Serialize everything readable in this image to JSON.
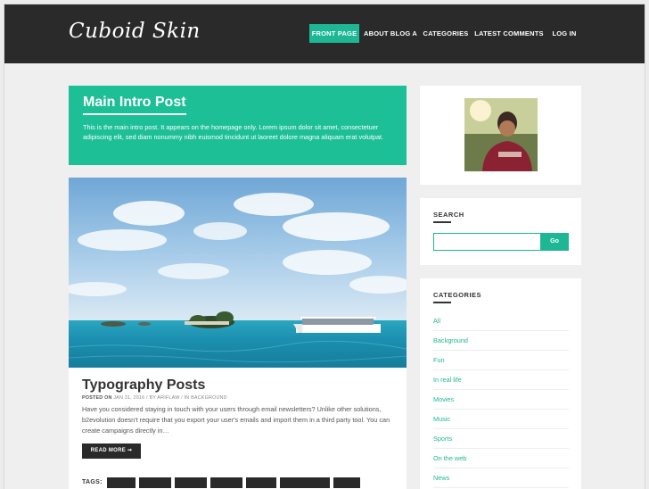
{
  "header": {
    "logo": "Cuboid Skin",
    "nav": [
      {
        "label": "FRONT PAGE",
        "active": true
      },
      {
        "label": "ABOUT BLOG A",
        "active": false
      },
      {
        "label": "CATEGORIES",
        "active": false
      },
      {
        "label": "LATEST COMMENTS",
        "active": false
      },
      {
        "label": "LOG IN",
        "active": false
      }
    ]
  },
  "intro": {
    "title": "Main Intro Post",
    "text": "This is the main intro post. It appears on the homepage only. Lorem ipsum dolor sit amet, consectetuer adipiscing elit, sed diam nonummy nibh euismod tincidunt ut laoreet dolore magna aliquam erat volutpat."
  },
  "post": {
    "title": "Typography Posts",
    "meta": {
      "posted_on_label": "POSTED ON",
      "date": "JAN 31, 2016",
      "by_label": "/ BY",
      "author": "ARIFLAW",
      "in_label": "/ IN",
      "category": "BACKGROUND"
    },
    "excerpt": "Have you considered staying in touch with your users through email newsletters? Unlike other solutions, b2evolution doesn't require that you export your user's emails and import them in a third party tool. You can create campaigns directly in…",
    "read_more": "READ MORE ➞",
    "tags_label": "TAGS:"
  },
  "sidebar": {
    "search": {
      "title": "SEARCH",
      "placeholder": "",
      "button": "Go"
    },
    "categories": {
      "title": "CATEGORIES",
      "items": [
        "All",
        "Background",
        "Fun",
        "In real life",
        "Movies",
        "Music",
        "Sports",
        "On the web",
        "News"
      ]
    }
  },
  "colors": {
    "accent": "#1eb795",
    "header_bg": "#2a2a2a",
    "intro_bg": "#1dbf97"
  }
}
